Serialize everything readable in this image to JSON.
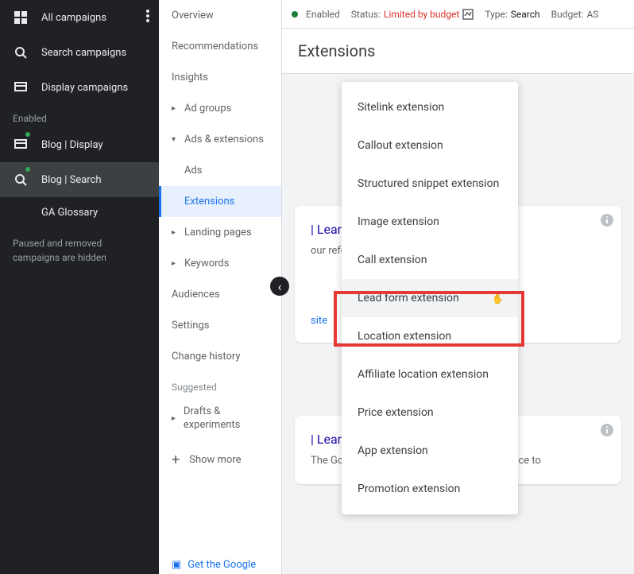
{
  "dark_sidebar": {
    "all": "All campaigns",
    "search": "Search campaigns",
    "display": "Display campaigns",
    "enabled_label": "Enabled",
    "blog_display": "Blog | Display",
    "blog_search": "Blog | Search",
    "ga_glossary": "GA Glossary",
    "hidden_note": "Paused and removed campaigns are hidden"
  },
  "sub_sidebar": {
    "overview": "Overview",
    "recommendations": "Recommendations",
    "insights": "Insights",
    "ad_groups": "Ad groups",
    "ads_ext": "Ads & extensions",
    "ads": "Ads",
    "extensions": "Extensions",
    "landing": "Landing pages",
    "keywords": "Keywords",
    "audiences": "Audiences",
    "settings": "Settings",
    "change_history": "Change history",
    "suggested": "Suggested",
    "drafts": "Drafts & experiments",
    "show_more": "Show more",
    "get_google": "Get the Google"
  },
  "status_bar": {
    "enabled": "Enabled",
    "status_label": "Status:",
    "status_value": "Limited by budget",
    "type_label": "Type:",
    "type_value": "Search",
    "budget_label": "Budget:",
    "budget_value": "AS"
  },
  "page": {
    "title": "Extensions"
  },
  "dropdown": {
    "items": [
      "Sitelink extension",
      "Callout extension",
      "Structured snippet extension",
      "Image extension",
      "Call extension",
      "Lead form extension",
      "Location extension",
      "Affiliate location extension",
      "Price extension",
      "App extension",
      "Promotion extension"
    ]
  },
  "ad_card1": {
    "headline": "| Learn",
    "desc": "our reference to earn all of the rms. Get the",
    "link": "site"
  },
  "ad_card2": {
    "headline": "| Learn",
    "desc": "The Google Analytics Glossary is your reference to"
  }
}
